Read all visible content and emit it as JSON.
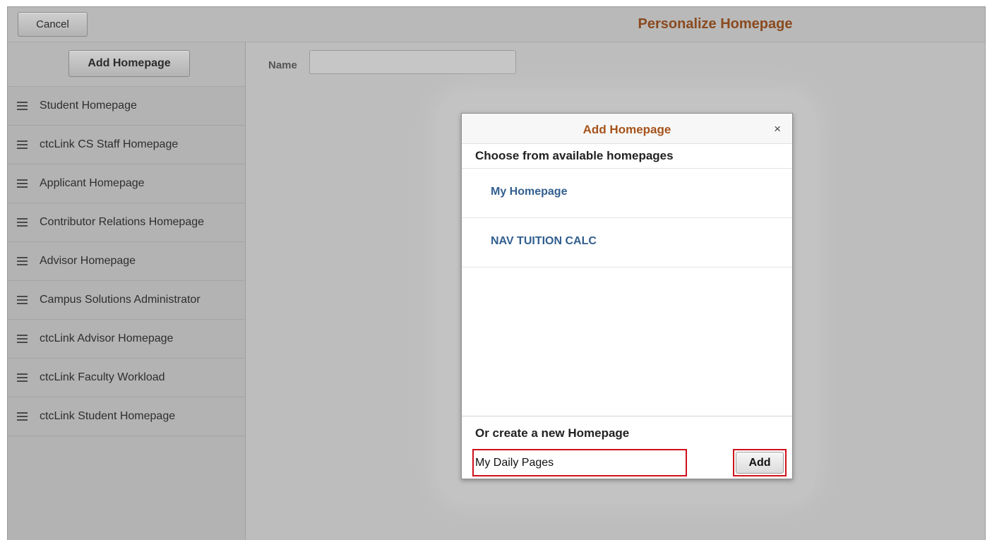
{
  "header": {
    "cancel_label": "Cancel",
    "title": "Personalize Homepage"
  },
  "sidebar": {
    "add_homepage_label": "Add Homepage",
    "items": [
      {
        "label": "Student Homepage"
      },
      {
        "label": "ctcLink CS Staff Homepage"
      },
      {
        "label": "Applicant Homepage"
      },
      {
        "label": "Contributor Relations Homepage"
      },
      {
        "label": "Advisor Homepage"
      },
      {
        "label": "Campus Solutions Administrator"
      },
      {
        "label": "ctcLink Advisor Homepage"
      },
      {
        "label": "ctcLink Faculty Workload"
      },
      {
        "label": "ctcLink Student Homepage"
      }
    ]
  },
  "main": {
    "name_label": "Name",
    "name_value": ""
  },
  "modal": {
    "title": "Add Homepage",
    "close_symbol": "×",
    "choose_title": "Choose from available homepages",
    "options": [
      {
        "label": "My Homepage"
      },
      {
        "label": "NAV TUITION CALC"
      }
    ],
    "create_title": "Or create a new Homepage",
    "new_name_value": "My Daily Pages",
    "add_label": "Add"
  },
  "colors": {
    "title": "#8a4a1e",
    "modal_title": "#a6531b",
    "link": "#325f8f",
    "highlight": "#d0111b"
  }
}
